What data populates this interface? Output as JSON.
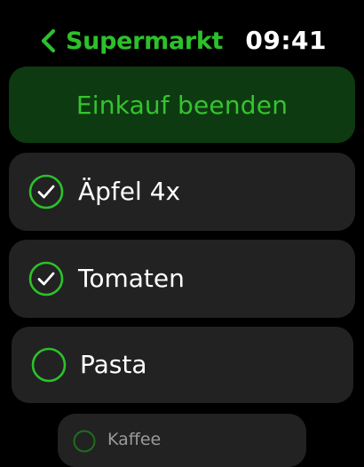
{
  "header": {
    "back_label": "Supermarkt",
    "time": "09:41"
  },
  "actions": {
    "finish_label": "Einkauf beenden"
  },
  "items": [
    {
      "label": "Äpfel 4x",
      "checked": true
    },
    {
      "label": "Tomaten",
      "checked": true
    },
    {
      "label": "Pasta",
      "checked": false
    },
    {
      "label": "Kaffee",
      "checked": false
    }
  ],
  "icons": {
    "back": "chevron-left-icon",
    "checked": "checkmark-circle-icon",
    "unchecked": "empty-circle-icon"
  },
  "colors": {
    "background": "#000000",
    "accent": "#2cc12b",
    "finish_button_bg": "#0e3a11",
    "row_bg": "#222222"
  }
}
